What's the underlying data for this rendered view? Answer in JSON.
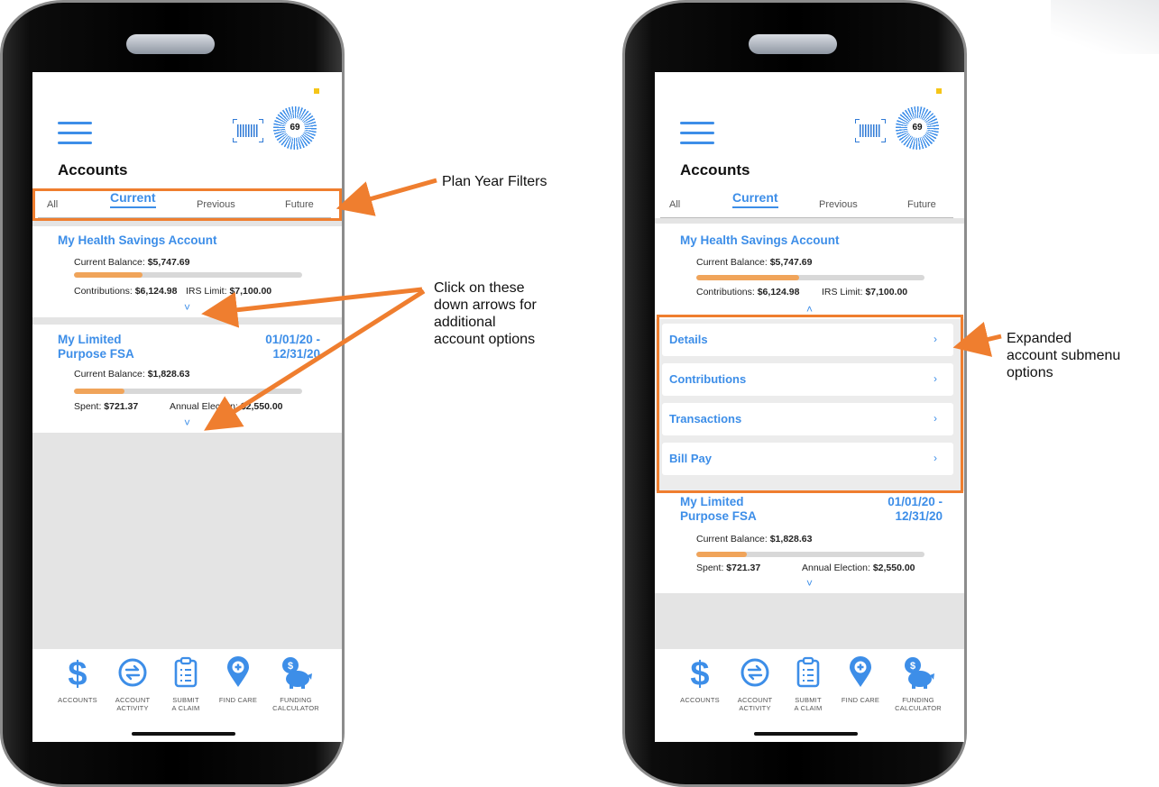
{
  "left_phone": {
    "page_title": "Accounts",
    "score": "69",
    "tabs": [
      "All",
      "Current",
      "Previous",
      "Future"
    ],
    "hsa": {
      "name": "My Health Savings Account",
      "balance_label": "Current Balance:",
      "balance_value": "$5,747.69",
      "progress": 0.3,
      "left_label": "Contributions:",
      "left_value": "$6,124.98",
      "right_label": "IRS Limit:",
      "right_value": "$7,100.00",
      "chevron": "˅"
    },
    "fsa": {
      "name_line1": "My Limited",
      "name_line2": "Purpose FSA",
      "date_line1": "01/01/20 -",
      "date_line2": "12/31/20",
      "balance_label": "Current Balance:",
      "balance_value": "$1,828.63",
      "progress": 0.22,
      "left_label": "Spent:",
      "left_value": "$721.37",
      "right_label": "Annual Election:",
      "right_value": "$2,550.00",
      "chevron": "˅"
    }
  },
  "right_phone": {
    "page_title": "Accounts",
    "score": "69",
    "tabs": [
      "All",
      "Current",
      "Previous",
      "Future"
    ],
    "hsa": {
      "name": "My Health Savings Account",
      "balance_label": "Current Balance:",
      "balance_value": "$5,747.69",
      "progress": 0.45,
      "left_label": "Contributions:",
      "left_value": "$6,124.98",
      "right_label": "IRS Limit:",
      "right_value": "$7,100.00",
      "chevron": "˄"
    },
    "submenu": [
      {
        "label": "Details",
        "arrow": "›"
      },
      {
        "label": "Contributions",
        "arrow": "›"
      },
      {
        "label": "Transactions",
        "arrow": "›"
      },
      {
        "label": "Bill Pay",
        "arrow": "›"
      }
    ],
    "fsa": {
      "name_line1": "My Limited",
      "name_line2": "Purpose FSA",
      "date_line1": "01/01/20 -",
      "date_line2": "12/31/20",
      "balance_label": "Current Balance:",
      "balance_value": "$1,828.63",
      "progress": 0.22,
      "left_label": "Spent:",
      "left_value": "$721.37",
      "right_label": "Annual Election:",
      "right_value": "$2,550.00",
      "chevron": "˅"
    }
  },
  "bottom_nav": [
    {
      "label_line1": "ACCOUNTS",
      "label_line2": "",
      "icon": "dollar-icon"
    },
    {
      "label_line1": "ACCOUNT",
      "label_line2": "ACTIVITY",
      "icon": "exchange-icon"
    },
    {
      "label_line1": "SUBMIT",
      "label_line2": "A CLAIM",
      "icon": "clipboard-icon"
    },
    {
      "label_line1": "FIND CARE",
      "label_line2": "",
      "icon": "map-pin-plus-icon"
    },
    {
      "label_line1": "FUNDING",
      "label_line2": "CALCULATOR",
      "icon": "piggy-bank-icon"
    }
  ],
  "annotations": {
    "plan_year_filters": "Plan Year Filters",
    "down_arrows_line1": "Click on these",
    "down_arrows_line2": "down arrows for",
    "down_arrows_line3": "additional",
    "down_arrows_line4": "account options",
    "expanded_line1": "Expanded",
    "expanded_line2": "account submenu",
    "expanded_line3": "options"
  },
  "colors": {
    "accent_blue": "#3d8ee8",
    "progress_orange": "#f0a45a",
    "highlight_orange": "#ef7e2f"
  }
}
